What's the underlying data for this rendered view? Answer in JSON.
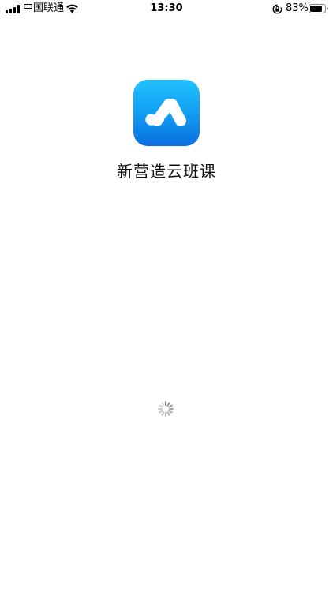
{
  "status_bar": {
    "carrier": "中国联通",
    "time": "13:30",
    "battery_percent": "83%",
    "battery_level": 0.83,
    "icons": [
      "signal-icon",
      "wifi-icon",
      "rotation-lock-icon",
      "battery-icon"
    ]
  },
  "splash": {
    "app_name": "新营造云班课",
    "icon": "app-logo-icon",
    "loading_indicator": "spinner-icon"
  },
  "colors": {
    "logo_gradient_top": "#22c2ff",
    "logo_gradient_bottom": "#0a6fe0",
    "background": "#ffffff",
    "text": "#111111"
  }
}
